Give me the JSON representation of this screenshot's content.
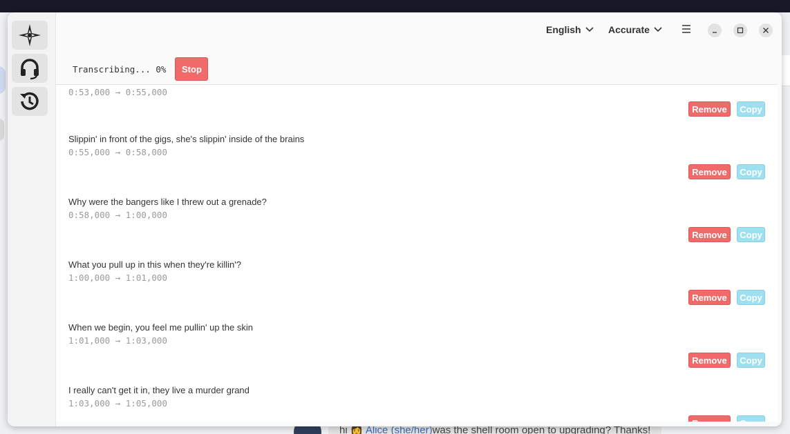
{
  "background": {
    "chat_mention": "Alice (she/her)",
    "chat_prefix": "hi",
    "chat_rest": "was the shell room open to upgrading? Thanks!"
  },
  "sidebar": {
    "items": [
      {
        "icon": "compass-star-icon"
      },
      {
        "icon": "headset-icon"
      },
      {
        "icon": "history-icon"
      }
    ]
  },
  "header": {
    "language": "English",
    "quality": "Accurate",
    "menu_icon": "hamburger-menu-icon"
  },
  "status": {
    "text": "Transcribing... 0%",
    "stop_label": "Stop"
  },
  "colors": {
    "remove": "#f06a6a",
    "copy": "#9ee0f0"
  },
  "segments": [
    {
      "text": "",
      "time": "0:53,000 → 0:55,000",
      "remove": "Remove",
      "copy": "Copy"
    },
    {
      "text": "Slippin' in front of the gigs, she's slippin' inside of the brains",
      "time": "0:55,000 → 0:58,000",
      "remove": "Remove",
      "copy": "Copy"
    },
    {
      "text": "Why were the bangers like I threw out a grenade?",
      "time": "0:58,000 → 1:00,000",
      "remove": "Remove",
      "copy": "Copy"
    },
    {
      "text": "What you pull up in this when they're killin'?",
      "time": "1:00,000 → 1:01,000",
      "remove": "Remove",
      "copy": "Copy"
    },
    {
      "text": "When we begin, you feel me pullin' up the skin",
      "time": "1:01,000 → 1:03,000",
      "remove": "Remove",
      "copy": "Copy"
    },
    {
      "text": "I really can't get it in, they live a murder grand",
      "time": "1:03,000 → 1:05,000",
      "remove": "Remove",
      "copy": "Copy"
    }
  ]
}
